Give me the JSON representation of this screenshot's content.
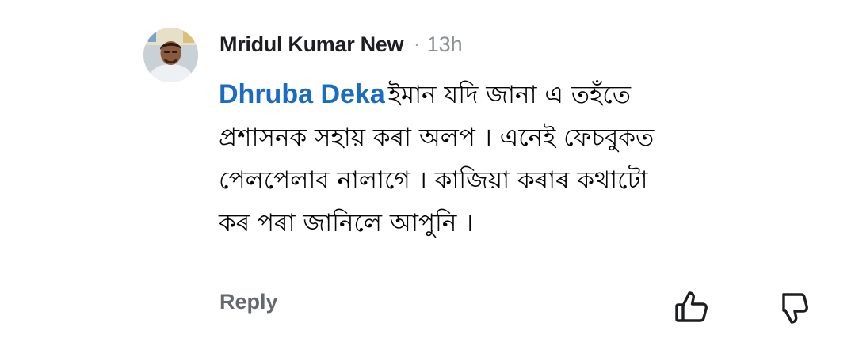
{
  "comment": {
    "author": "Mridul Kumar New",
    "separator": "·",
    "time": "13h",
    "mention": "Dhruba Deka",
    "lines": [
      "ইমান যদি জানা এ তহঁতে",
      "প্ৰশাসনক সহায় কৰা অলপ । এনেই ফেচবুকত",
      "পেলপেলাব নালাগে । কাজিয়া কৰাৰ কথাটো",
      "কৰ পৰা জানিলে আপুনি ।"
    ]
  },
  "actions": {
    "reply_label": "Reply",
    "like_icon": "thumbs-up-icon",
    "dislike_icon": "thumbs-down-icon"
  },
  "colors": {
    "mention": "#1b6bc4",
    "muted": "#65686c"
  }
}
